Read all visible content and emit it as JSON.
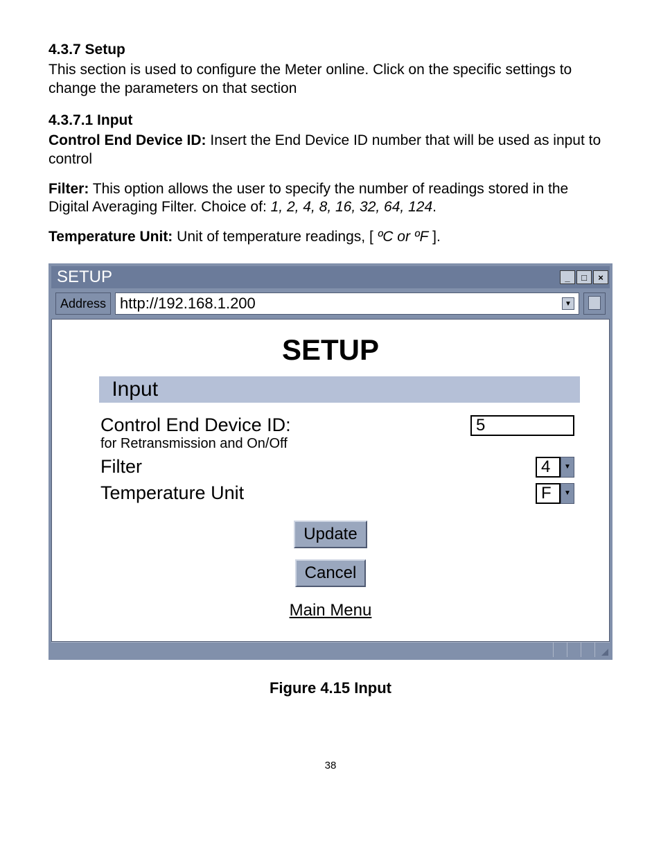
{
  "doc": {
    "h1": "4.3.7 Setup",
    "p1": "This section is used to configure the Meter online. Click on the specific settings to change the parameters on that section",
    "h2": "4.3.7.1 Input",
    "p2a_b": "Control End Device ID:",
    "p2a_r": "  Insert the End Device ID number that will be used as input to control",
    "p3_b": "Filter:",
    "p3_r": "  This option allows the user to specify the number of readings stored in the Digital Averaging Filter.   Choice of: ",
    "p3_i": "1, 2, 4, 8, 16, 32, 64, 124",
    "p3_end": ".",
    "p4_b": "Temperature Unit:",
    "p4_r": "  Unit of temperature readings, [ ",
    "p4_i": "ºC or ºF",
    "p4_end": " ].",
    "caption": "Figure 4.15  Input",
    "pagenum": "38"
  },
  "window": {
    "title": "SETUP",
    "address_label": "Address",
    "url": "http://192.168.1.200",
    "heading": "SETUP",
    "input_bar": "Input",
    "row1_label": "Control End Device ID:",
    "row1_sub": "for Retransmission and On/Off",
    "row1_value": "5",
    "row2_label": "Filter",
    "row2_value": "4",
    "row3_label": "Temperature Unit",
    "row3_value": "F",
    "btn_update": "Update",
    "btn_cancel": "Cancel",
    "link_main": "Main Menu"
  }
}
